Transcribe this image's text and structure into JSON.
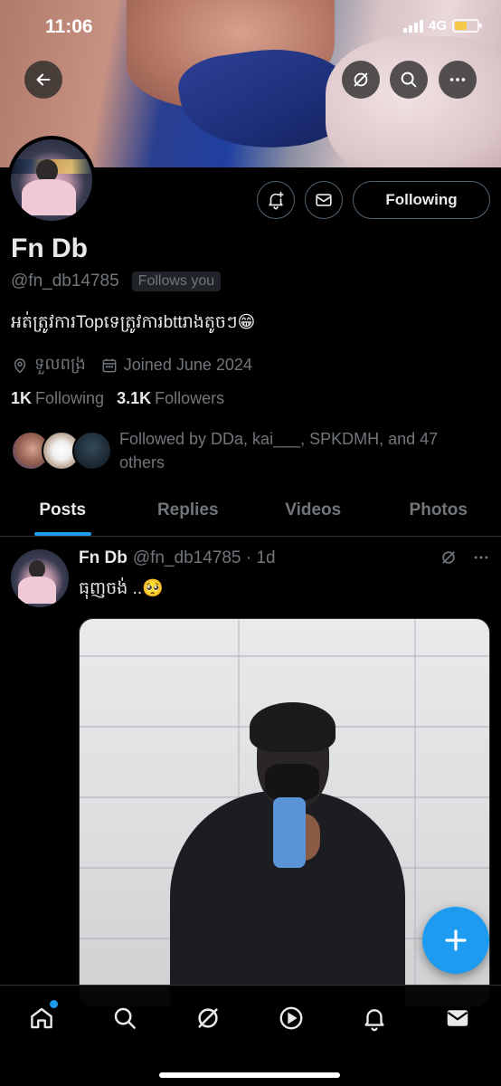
{
  "status_bar": {
    "time": "11:06",
    "network": "4G"
  },
  "profile": {
    "display_name": "Fn Db",
    "handle": "@fn_db14785",
    "follows_you_badge": "Follows you",
    "bio": "អត់ត្រូវការTopទេត្រូវការbttរាងតូចៗ😁",
    "location": "ទួលពង្រ",
    "joined": "Joined June 2024",
    "following_count": "1K",
    "following_label": "Following",
    "followers_count": "3.1K",
    "followers_label": "Followers",
    "followed_by": "Followed by DDa, kai___, SPKDMH, and 47 others",
    "following_button": "Following"
  },
  "tabs": [
    {
      "label": "Posts",
      "active": true
    },
    {
      "label": "Replies",
      "active": false
    },
    {
      "label": "Videos",
      "active": false
    },
    {
      "label": "Photos",
      "active": false
    }
  ],
  "post": {
    "author_name": "Fn Db",
    "author_handle": "@fn_db14785 · 1d",
    "text": "ធុញចង់ ..🥺"
  },
  "icons": {
    "back": "back-arrow-icon",
    "grok": "grok-icon",
    "search": "search-icon",
    "more": "more-icon",
    "notify": "notification-bell-plus-icon",
    "message": "mail-icon",
    "location": "location-pin-icon",
    "calendar": "calendar-icon",
    "compose": "plus-icon"
  },
  "bottom_nav": [
    {
      "name": "home",
      "has_dot": true
    },
    {
      "name": "search"
    },
    {
      "name": "grok"
    },
    {
      "name": "video"
    },
    {
      "name": "notifications"
    },
    {
      "name": "messages"
    }
  ],
  "colors": {
    "accent": "#1d9bf0",
    "background": "#000000",
    "muted": "#71767b",
    "text": "#e7e9ea",
    "border": "#2f3336"
  }
}
